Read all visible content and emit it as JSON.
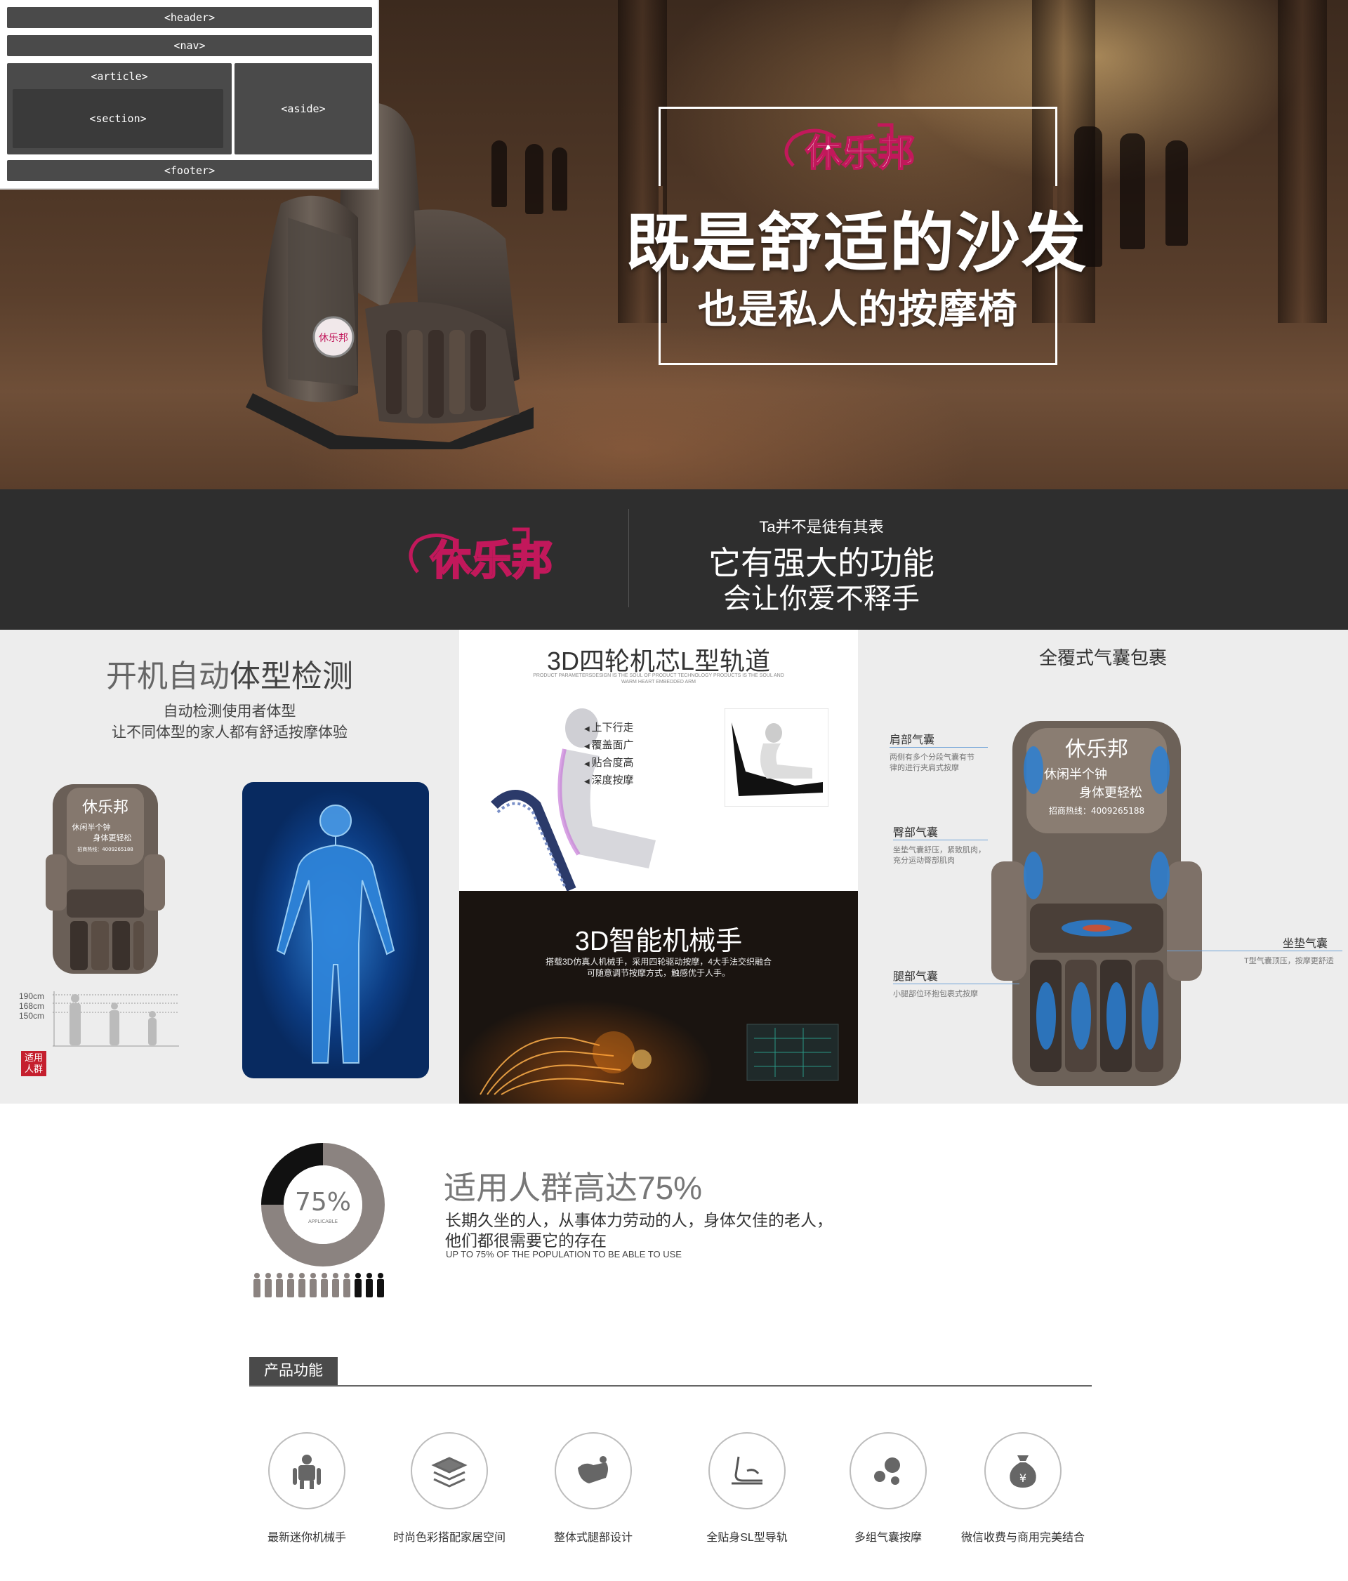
{
  "overlay": {
    "header": "<header>",
    "nav": "<nav>",
    "article": "<article>",
    "section": "<section>",
    "aside": "<aside>",
    "footer": "<footer>"
  },
  "hero": {
    "logo_text": "休乐邦",
    "title_line_1": "既是舒适的沙发",
    "title_line_2": "也是私人的按摩椅",
    "chair_badge": "休乐邦"
  },
  "brand_bar": {
    "logo_text": "休乐邦",
    "small_line": "Ta并不是徒有其表",
    "line_1": "它有强大的功能",
    "line_2": "会让你爱不释手"
  },
  "panel_body": {
    "title_light": "开机自动",
    "title_dark": "体型检测",
    "desc_1": "自动检测使用者体型",
    "desc_2": "让不同体型的家人都有舒适按摩体验",
    "heights": [
      "190cm",
      "168cm",
      "150cm"
    ],
    "badge": "适用人群",
    "chair_logo": "休乐邦",
    "chair_line_1": "休闲半个钟",
    "chair_line_2": "身体更轻松",
    "chair_hotline": "招商热线：4009265188"
  },
  "panel_track": {
    "title": "3D四轮机芯L型轨道",
    "subtitle": "PRODUCT PARAMETERSDESIGN IS THE SOUL OF PRODUCT TECHNOLOGY PRODUCTS IS THE SOUL AND WARM HEART EMBEDDED ARM",
    "labels": [
      "上下行走",
      "覆盖面广",
      "贴合度高",
      "深度按摩"
    ],
    "dark_title": "3D智能机械手",
    "dark_desc_1": "搭载3D仿真人机械手，采用四轮驱动按摩，4大手法交织融合",
    "dark_desc_2": "可随意调节按摩方式，触感优于人手。"
  },
  "panel_airbag": {
    "title": "全覆式气囊包裹",
    "chair_logo": "休乐邦",
    "chair_line_1": "休闲半个钟",
    "chair_line_2": "身体更轻松",
    "chair_hotline": "招商热线：4009265188",
    "shoulder": {
      "label": "肩部气囊",
      "desc": "两侧有多个分段气囊有节律的进行夹肩式按摩"
    },
    "hip": {
      "label": "臀部气囊",
      "desc": "坐垫气囊舒压，紧致肌肉，充分运动臀部肌肉"
    },
    "leg": {
      "label": "腿部气囊",
      "desc": "小腿部位环抱包裹式按摩"
    },
    "seat": {
      "label": "坐垫气囊",
      "desc": "T型气囊顶压，按摩更舒适"
    }
  },
  "stat": {
    "donut_value": "75%",
    "donut_caption": "APPLICABLE",
    "percent": 75,
    "title": "适用人群高达75%",
    "desc_1": "长期久坐的人，从事体力劳动的人，身体欠佳的老人，",
    "desc_2": "他们都很需要它的存在",
    "english": "UP TO 75% OF THE POPULATION TO BE ABLE TO USE",
    "people_total": 12,
    "people_highlighted": 3
  },
  "features": {
    "tab_label": "产品功能",
    "items": [
      {
        "label": "最新迷你机械手",
        "icon": "robot-hand-icon"
      },
      {
        "label": "时尚色彩搭配家居空间",
        "icon": "layers-icon"
      },
      {
        "label": "整体式腿部设计",
        "icon": "leg-rest-icon"
      },
      {
        "label": "全贴身SL型导轨",
        "icon": "sl-rail-icon"
      },
      {
        "label": "多组气囊按摩",
        "icon": "airbag-dots-icon"
      },
      {
        "label": "微信收费与商用完美结合",
        "icon": "money-bag-icon"
      }
    ]
  },
  "colors": {
    "brand_pink": "#c2185b",
    "dark_bar": "#2e2e2e",
    "panel_gray": "#ededed",
    "airbag_blue": "#2a7fd4",
    "badge_red": "#c51f2e"
  }
}
